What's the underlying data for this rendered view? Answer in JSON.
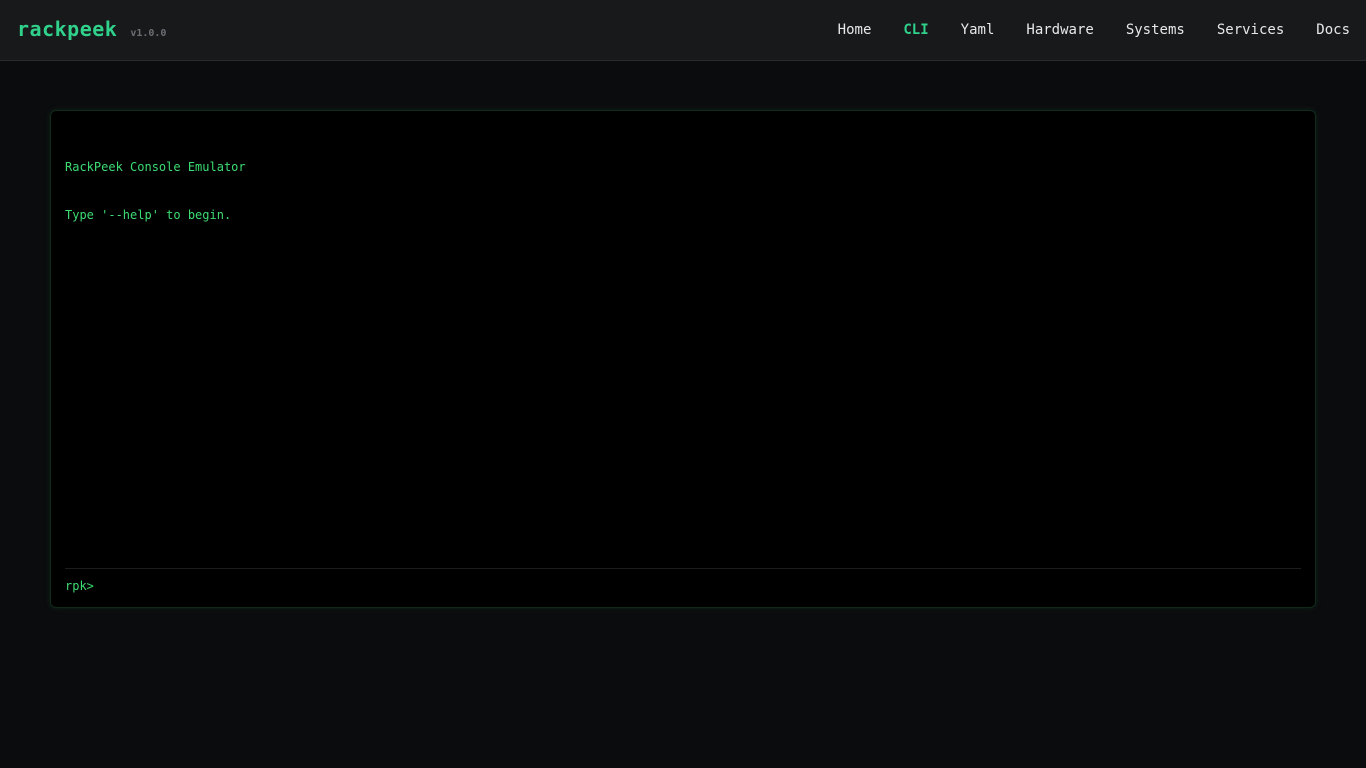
{
  "header": {
    "brand": "rackpeek",
    "version": "v1.0.0",
    "nav": [
      {
        "label": "Home"
      },
      {
        "label": "CLI"
      },
      {
        "label": "Yaml"
      },
      {
        "label": "Hardware"
      },
      {
        "label": "Systems"
      },
      {
        "label": "Services"
      },
      {
        "label": "Docs"
      }
    ],
    "active_nav": "CLI"
  },
  "console": {
    "output_lines": [
      "RackPeek Console Emulator",
      "Type '--help' to begin."
    ],
    "prompt": "rpk>",
    "input_value": "",
    "input_placeholder": ""
  },
  "colors": {
    "accent": "#2fd18b",
    "terminal_text": "#3ddc73",
    "page_bg": "#0b0c0e",
    "header_bg": "#18191b",
    "console_bg": "#000000"
  }
}
